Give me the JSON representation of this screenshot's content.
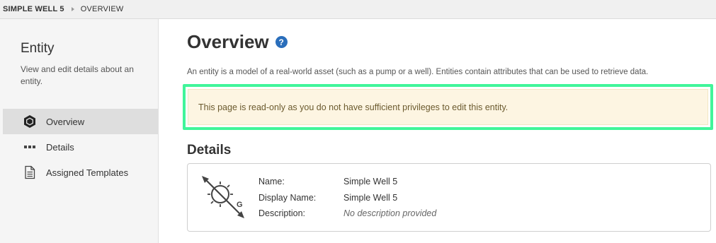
{
  "breadcrumb": {
    "root": "SIMPLE WELL 5",
    "current": "OVERVIEW"
  },
  "sidebar": {
    "title": "Entity",
    "description": "View and edit details about an entity.",
    "items": [
      {
        "label": "Overview",
        "icon": "hexagon-icon",
        "active": true
      },
      {
        "label": "Details",
        "icon": "ellipsis-icon",
        "active": false
      },
      {
        "label": "Assigned Templates",
        "icon": "document-icon",
        "active": false
      }
    ]
  },
  "main": {
    "title": "Overview",
    "help_icon": "question-circle-icon",
    "intro": "An entity is a model of a real-world asset (such as a pump or a well). Entities contain attributes that can be used to retrieve data.",
    "alert": "This page is read-only as you do not have sufficient privileges to edit this entity.",
    "details_title": "Details",
    "entity_icon": "well-gauge-icon",
    "properties": [
      {
        "label": "Name:",
        "value": "Simple Well 5"
      },
      {
        "label": "Display Name:",
        "value": "Simple Well 5"
      },
      {
        "label": "Description:",
        "value": "No description provided"
      }
    ]
  },
  "colors": {
    "accent": "#2a6ebb",
    "highlight": "#41f59a",
    "alert_bg": "#fdf5e2",
    "sidebar_bg": "#f5f5f5",
    "active_bg": "#dedede"
  }
}
